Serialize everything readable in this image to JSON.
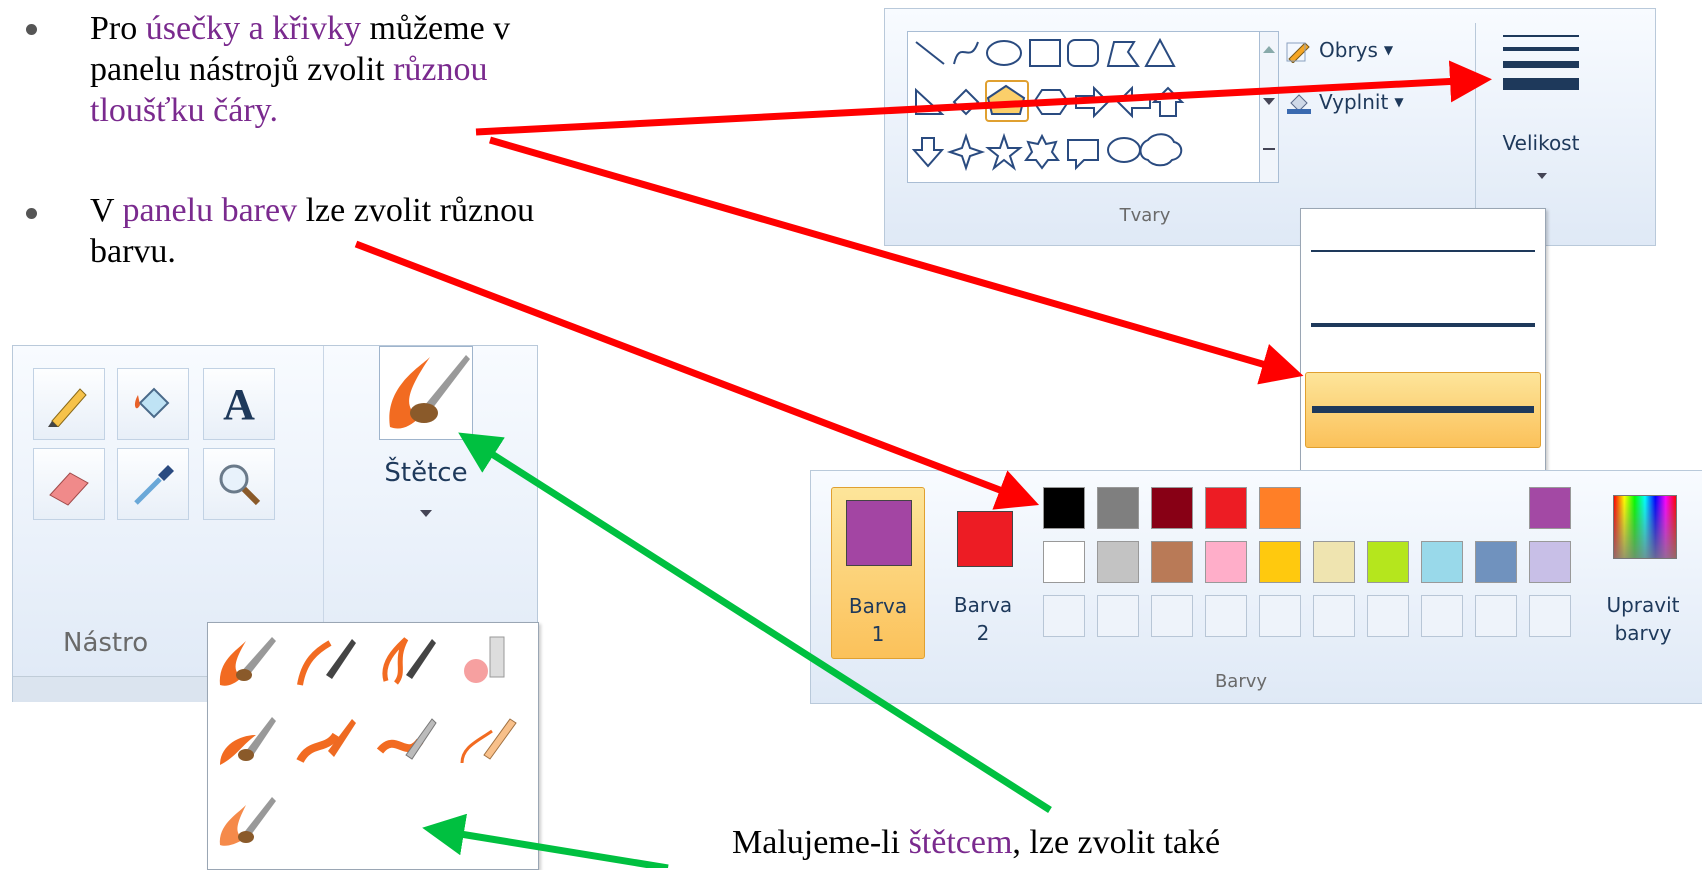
{
  "bullets": [
    {
      "line1_pre": "Pro ",
      "line1_hl": "úsečky a křivky",
      "line1_post": " můžeme v",
      "line2_pre": "panelu nástrojů zvolit ",
      "line2_hl": "různou",
      "line3_hl": "tloušťku čáry",
      "line3_post": "."
    },
    {
      "line1_pre": "V ",
      "line1_hl": "panelu barev",
      "line1_post": " lze zvolit různou",
      "line2": "barvu."
    }
  ],
  "caption": {
    "pre": "Malujeme-li ",
    "hl": "štětcem",
    "post": ", lze zvolit také"
  },
  "shapes_panel": {
    "outline_label": "Obrys",
    "fill_label": "Vyplnit",
    "group_label": "Tvary",
    "size_label": "Velikost"
  },
  "tools_panel": {
    "brushes_label": "Štětce",
    "group_label": "Nástro"
  },
  "colors_panel": {
    "color1_label_a": "Barva",
    "color1_label_b": "1",
    "color2_label_a": "Barva",
    "color2_label_b": "2",
    "edit_label_a": "Upravit",
    "edit_label_b": "barvy",
    "group_label": "Barvy",
    "color1": "#a345a3",
    "color2": "#ed1c24",
    "row1": [
      "#000000",
      "#7f7f7f",
      "#880015",
      "#ed1c24",
      "#ff7f27",
      "#fff200",
      "#22b14c",
      "#00a2e8",
      "#3f48cc",
      "#a349a4"
    ],
    "row2": [
      "#ffffff",
      "#c3c3c3",
      "#b97a57",
      "#ffaec9",
      "#ffc90e",
      "#efe4b0",
      "#b5e61d",
      "#99d9ea",
      "#7092be",
      "#c8bfe7"
    ]
  },
  "colors": {
    "highlight": "#7a2a8e",
    "red_arrow": "#ff0000",
    "green_arrow": "#00c040",
    "ribbon_text": "#1e395b",
    "selected": "#fbcf6a"
  },
  "icons": [
    "pencil-icon",
    "fill-bucket-icon",
    "text-icon",
    "eraser-icon",
    "color-picker-icon",
    "magnifier-icon",
    "brush-icon",
    "outline-icon",
    "fill-icon"
  ]
}
